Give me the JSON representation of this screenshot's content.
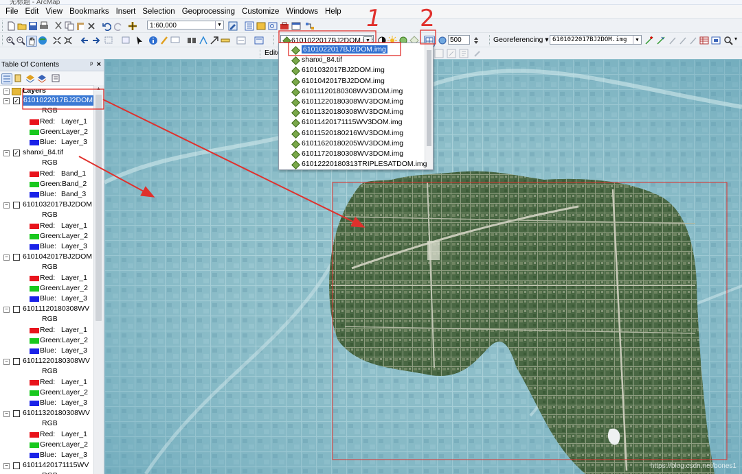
{
  "window": {
    "title": "无标题 - ArcMap"
  },
  "menu": [
    "File",
    "Edit",
    "View",
    "Bookmarks",
    "Insert",
    "Selection",
    "Geoprocessing",
    "Customize",
    "Windows",
    "Help"
  ],
  "toolbar": {
    "scale_value": "1:60,000",
    "active_layer": "6101022017BJ2DOM.img",
    "resolution_value": "500",
    "georeferencing_label": "Georeferencing",
    "georef_layer": "6101022017BJ2DOM.img",
    "editor_label": "Editor"
  },
  "layer_dropdown": {
    "items": [
      "6101022017BJ2DOM.img",
      "shanxi_84.tif",
      "6101032017BJ2DOM.img",
      "6101042017BJ2DOM.img",
      "61011120180308WV3DOM.img",
      "61011220180308WV3DOM.img",
      "61011320180308WV3DOM.img",
      "61011420171115WV3DOM.img",
      "61011520180216WV3DOM.img",
      "61011620180205WV3DOM.img",
      "61011720180308WV3DOM.img",
      "61012220180313TRIPLESATDOM.img"
    ],
    "selected_index": 0
  },
  "toc": {
    "title": "Table Of Contents",
    "pin": "ᵖ",
    "close": "×",
    "root": "Layers",
    "layers": [
      {
        "name": "6101022017BJ2DOM",
        "checked": true,
        "selected": true,
        "type": "RGB",
        "bands": [
          {
            "label": "Red:",
            "value": "Layer_1",
            "color": "#e8141c"
          },
          {
            "label": "Green:",
            "value": "Layer_2",
            "color": "#19c81e"
          },
          {
            "label": "Blue:",
            "value": "Layer_3",
            "color": "#1a22e8"
          }
        ]
      },
      {
        "name": "shanxi_84.tif",
        "checked": true,
        "selected": false,
        "type": "RGB",
        "bands": [
          {
            "label": "Red:",
            "value": "Band_1",
            "color": "#e8141c"
          },
          {
            "label": "Green:",
            "value": "Band_2",
            "color": "#19c81e"
          },
          {
            "label": "Blue:",
            "value": "Band_3",
            "color": "#1a22e8"
          }
        ]
      },
      {
        "name": "6101032017BJ2DOM",
        "checked": false,
        "selected": false,
        "type": "RGB",
        "bands": [
          {
            "label": "Red:",
            "value": "Layer_1",
            "color": "#e8141c"
          },
          {
            "label": "Green:",
            "value": "Layer_2",
            "color": "#19c81e"
          },
          {
            "label": "Blue:",
            "value": "Layer_3",
            "color": "#1a22e8"
          }
        ]
      },
      {
        "name": "6101042017BJ2DOM",
        "checked": false,
        "selected": false,
        "type": "RGB",
        "bands": [
          {
            "label": "Red:",
            "value": "Layer_1",
            "color": "#e8141c"
          },
          {
            "label": "Green:",
            "value": "Layer_2",
            "color": "#19c81e"
          },
          {
            "label": "Blue:",
            "value": "Layer_3",
            "color": "#1a22e8"
          }
        ]
      },
      {
        "name": "61011120180308WV",
        "checked": false,
        "selected": false,
        "type": "RGB",
        "bands": [
          {
            "label": "Red:",
            "value": "Layer_1",
            "color": "#e8141c"
          },
          {
            "label": "Green:",
            "value": "Layer_2",
            "color": "#19c81e"
          },
          {
            "label": "Blue:",
            "value": "Layer_3",
            "color": "#1a22e8"
          }
        ]
      },
      {
        "name": "61011220180308WV",
        "checked": false,
        "selected": false,
        "type": "RGB",
        "bands": [
          {
            "label": "Red:",
            "value": "Layer_1",
            "color": "#e8141c"
          },
          {
            "label": "Green:",
            "value": "Layer_2",
            "color": "#19c81e"
          },
          {
            "label": "Blue:",
            "value": "Layer_3",
            "color": "#1a22e8"
          }
        ]
      },
      {
        "name": "61011320180308WV",
        "checked": false,
        "selected": false,
        "type": "RGB",
        "bands": [
          {
            "label": "Red:",
            "value": "Layer_1",
            "color": "#e8141c"
          },
          {
            "label": "Green:",
            "value": "Layer_2",
            "color": "#19c81e"
          },
          {
            "label": "Blue:",
            "value": "Layer_3",
            "color": "#1a22e8"
          }
        ]
      },
      {
        "name": "61011420171115WV",
        "checked": false,
        "selected": false,
        "type": "RGB",
        "bands": []
      }
    ]
  },
  "annotations": {
    "mark_1": "1",
    "mark_2": "2"
  },
  "watermark": "https://blog.csdn.net/bones1"
}
